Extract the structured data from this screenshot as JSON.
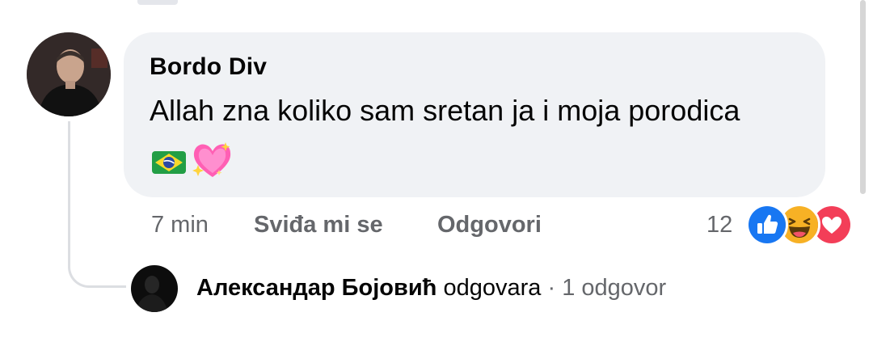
{
  "comment": {
    "author": "Bordo Div",
    "text": "Allah zna koliko sam sretan ja i moja porodica",
    "emojis": [
      "brazil-flag-icon",
      "sparkling-heart-icon"
    ],
    "time": "7 min",
    "like_label": "Sviđa mi se",
    "reply_label": "Odgovori",
    "reaction_count": "12",
    "reactions": [
      "like-reaction-icon",
      "haha-reaction-icon",
      "love-reaction-icon"
    ]
  },
  "reply_summary": {
    "name": "Александар Бојовић",
    "verb": "odgovara",
    "separator": "·",
    "count": "1 odgovor"
  },
  "colors": {
    "bubble": "#f0f2f5",
    "secondary_text": "#65676b",
    "like_blue": "#1877f2",
    "haha_yellow": "#f7b125",
    "love_red": "#f33e58"
  }
}
